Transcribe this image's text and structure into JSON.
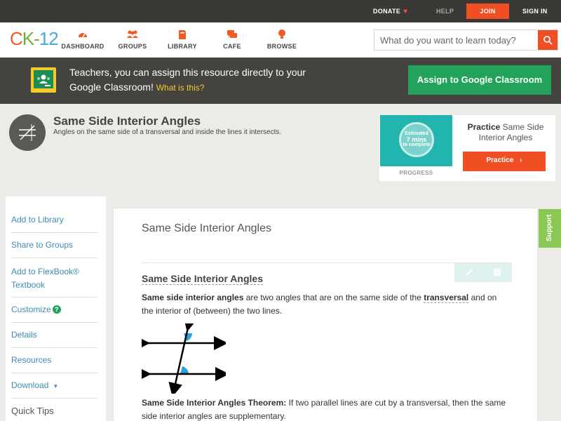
{
  "topbar": {
    "donate": "DONATE",
    "help": "HELP",
    "join": "JOIN",
    "signin": "SIGN IN"
  },
  "nav": {
    "logo": {
      "c": "C",
      "k": "K",
      "dash": "-",
      "num": "12"
    },
    "items": [
      {
        "label": "DASHBOARD",
        "icon": "dashboard-icon"
      },
      {
        "label": "GROUPS",
        "icon": "groups-icon"
      },
      {
        "label": "LIBRARY",
        "icon": "library-icon"
      },
      {
        "label": "CAFE",
        "icon": "cafe-icon"
      },
      {
        "label": "BROWSE",
        "icon": "browse-icon"
      }
    ],
    "search_placeholder": "What do you want to learn today?"
  },
  "banner": {
    "text": "Teachers, you can assign this resource directly to your Google Classroom!",
    "what": "What is this?",
    "button": "Assign to Google Classroom"
  },
  "concept": {
    "title": "Same Side Interior Angles",
    "description": "Angles on the same side of a transversal and inside the lines it intersects."
  },
  "practice": {
    "circle_line1": "Estimated",
    "circle_line2": "7 mins",
    "circle_line3": "to complete",
    "progress": "PROGRESS",
    "title_bold": "Practice",
    "title_rest": "Same Side Interior Angles",
    "button": "Practice"
  },
  "sidebar": {
    "items": [
      "Add to Library",
      "Share to Groups",
      "Add to FlexBook® Textbook",
      "Customize",
      "Details",
      "Resources",
      "Download"
    ],
    "quick_tips": "Quick Tips"
  },
  "content": {
    "title": "Same Side Interior Angles",
    "heading": "Same Side Interior Angles",
    "para1_bold": "Same side interior angles",
    "para1_mid": " are two angles that are on the same side of the ",
    "para1_term": "transversal",
    "para1_end": " and on the interior of (between) the two lines.",
    "theorem_bold": "Same Side Interior Angles Theorem:",
    "theorem_text": " If two parallel lines are cut by a transversal, then the same side interior angles are supplementary."
  },
  "support": "Support",
  "colors": {
    "accent": "#f04f23",
    "classroom_green": "#23a25a",
    "link": "#3d8bb5",
    "angle_blue": "#2f9fe0"
  }
}
